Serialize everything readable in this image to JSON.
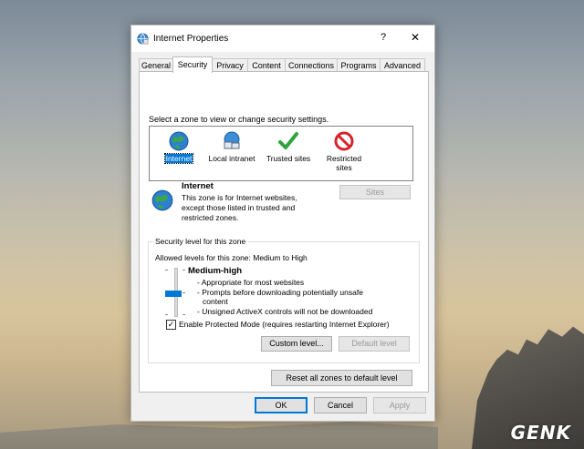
{
  "window": {
    "title": "Internet Properties",
    "help": "?",
    "close": "✕"
  },
  "tabs": [
    "General",
    "Security",
    "Privacy",
    "Content",
    "Connections",
    "Programs",
    "Advanced"
  ],
  "active_tab": "Security",
  "zone_prompt": "Select a zone to view or change security settings.",
  "zones": [
    {
      "label": "Internet",
      "icon": "globe-icon",
      "selected": true
    },
    {
      "label": "Local intranet",
      "icon": "intranet-icon",
      "selected": false
    },
    {
      "label": "Trusted sites",
      "icon": "checkmark-icon",
      "selected": false
    },
    {
      "label": "Restricted sites",
      "icon": "restricted-icon",
      "selected": false
    }
  ],
  "zone_info": {
    "name": "Internet",
    "desc_line1": "This zone is for Internet websites,",
    "desc_line2": "except those listed in trusted and",
    "desc_line3": "restricted zones.",
    "sites_button": "Sites"
  },
  "security_level": {
    "group_title": "Security level for this zone",
    "allowed": "Allowed levels for this zone: Medium to High",
    "level_name": "Medium-high",
    "bullet1": "- Appropriate for most websites",
    "bullet2a": "- Prompts before downloading potentially unsafe",
    "bullet2b": "content",
    "bullet3": "- Unsigned ActiveX controls will not be downloaded",
    "slider_level": "Medium-high"
  },
  "protected_mode": {
    "label": "Enable Protected Mode (requires restarting Internet Explorer)",
    "checked": true,
    "mark": "✓"
  },
  "buttons": {
    "custom_level": "Custom level...",
    "default_level": "Default level",
    "reset_all": "Reset all zones to default level",
    "ok": "OK",
    "cancel": "Cancel",
    "apply": "Apply"
  },
  "watermark": "GENK",
  "colors": {
    "accent": "#0078d7",
    "panel": "#ffffff",
    "chrome": "#f0f0f0"
  }
}
